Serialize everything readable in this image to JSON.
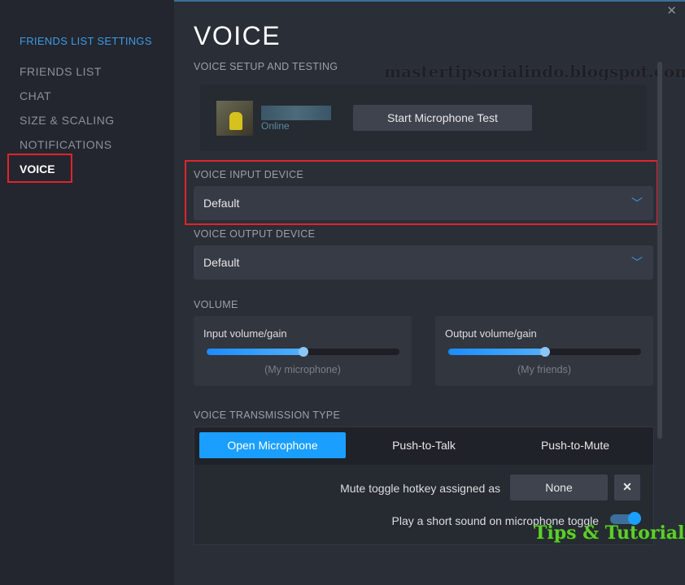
{
  "sidebar": {
    "header": "FRIENDS LIST SETTINGS",
    "items": [
      {
        "label": "FRIENDS LIST"
      },
      {
        "label": "CHAT"
      },
      {
        "label": "SIZE & SCALING"
      },
      {
        "label": "NOTIFICATIONS"
      },
      {
        "label": "VOICE",
        "selected": true
      }
    ]
  },
  "page": {
    "title": "VOICE"
  },
  "setup": {
    "label": "VOICE SETUP AND TESTING",
    "status": "Online",
    "test_button": "Start Microphone Test"
  },
  "input_device": {
    "label": "VOICE INPUT DEVICE",
    "value": "Default"
  },
  "output_device": {
    "label": "VOICE OUTPUT DEVICE",
    "value": "Default"
  },
  "volume": {
    "label": "VOLUME",
    "input": {
      "title": "Input volume/gain",
      "sub": "(My microphone)",
      "level_percent": 50
    },
    "output": {
      "title": "Output volume/gain",
      "sub": "(My friends)",
      "level_percent": 50
    }
  },
  "transmission": {
    "label": "VOICE TRANSMISSION TYPE",
    "tabs": [
      {
        "label": "Open Microphone",
        "active": true
      },
      {
        "label": "Push-to-Talk"
      },
      {
        "label": "Push-to-Mute"
      }
    ],
    "hotkey_label": "Mute toggle hotkey assigned as",
    "hotkey_value": "None",
    "sound_label": "Play a short sound on microphone toggle",
    "sound_on": true
  },
  "watermarks": {
    "top": "mastertipsorialindo.blogspot.com",
    "bottom": "Tips & Tutorial"
  },
  "colors": {
    "accent": "#1a9fff",
    "highlight": "#e0242b"
  }
}
